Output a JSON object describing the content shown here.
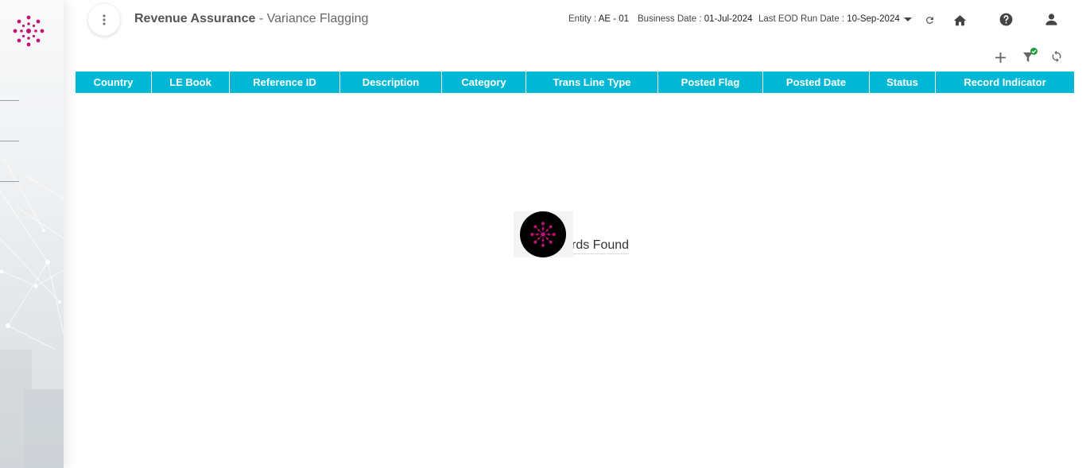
{
  "header": {
    "title_main": "Revenue Assurance",
    "title_separator": " - ",
    "title_sub": "Variance Flagging",
    "entity_label": "Entity :",
    "entity_value": "AE - 01",
    "business_date_label": "Business Date :",
    "business_date_value": "01-Jul-2024",
    "last_eod_label": "Last EOD Run Date :",
    "last_eod_value": "10-Sep-2024"
  },
  "icons": {
    "menu": "more-vert-icon",
    "dropdown": "caret-down-icon",
    "refresh_date": "refresh-icon",
    "home": "home-icon",
    "help": "help-icon",
    "user": "person-icon",
    "add": "plus-icon",
    "filter": "filter-icon",
    "reload": "sync-icon"
  },
  "colors": {
    "table_header_bg": "#00b8d6",
    "brand_magenta": "#c2127a",
    "filter_badge": "#1f9e3a"
  },
  "table": {
    "columns": [
      "Country",
      "LE Book",
      "Reference ID",
      "Description",
      "Category",
      "Trans Line Type",
      "Posted Flag",
      "Posted Date",
      "Status",
      "Record Indicator"
    ]
  },
  "empty_state": {
    "visible_text": "rds Found"
  }
}
